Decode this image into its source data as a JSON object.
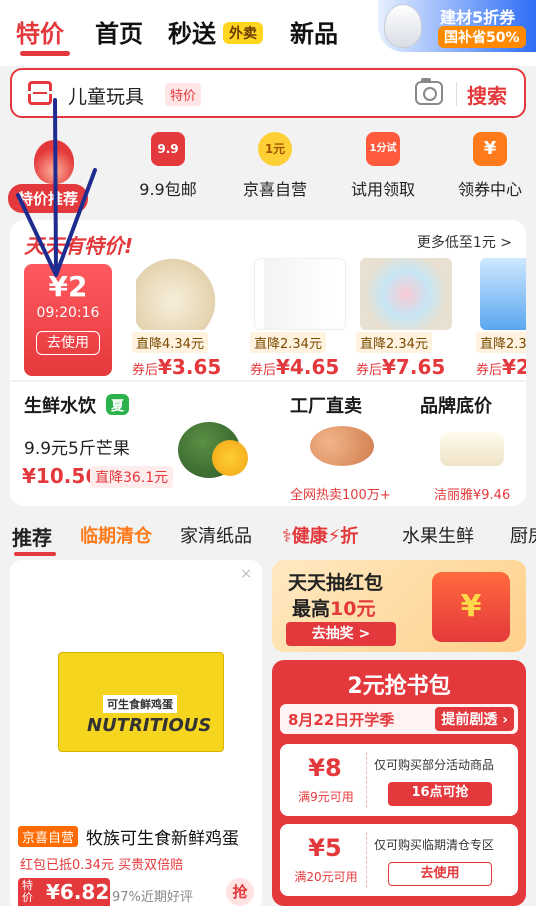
{
  "top_tabs": [
    {
      "label": "特价",
      "active": true
    },
    {
      "label": "首页"
    },
    {
      "label": "秒送"
    },
    {
      "label": "新品"
    }
  ],
  "waimai_badge": "外卖",
  "promo_banner": {
    "line1": "建材5折券",
    "line2": "国补省50%"
  },
  "search": {
    "text": "儿童玩具",
    "tag": "特价",
    "button": "搜索"
  },
  "quick_nav": {
    "tejia": {
      "label": "特价推荐"
    },
    "items": [
      {
        "icon_text": "9.9",
        "label": "9.9包邮"
      },
      {
        "icon_text": "1元",
        "label": "京喜自营"
      },
      {
        "icon_text": "1分试",
        "label": "试用领取"
      },
      {
        "icon_text": "¥",
        "label": "领券中心"
      }
    ]
  },
  "deals": {
    "title": "天天有特价!",
    "more": "更多低至1元 >",
    "coupon": {
      "amount": "¥2",
      "timer": "09:20:16",
      "button": "去使用"
    },
    "items": [
      {
        "drop": "直降4.34元",
        "after_label": "券后",
        "after_price": "¥3.65"
      },
      {
        "drop": "直降2.34元",
        "after_label": "券后",
        "after_price": "¥4.65"
      },
      {
        "drop": "直降2.34元",
        "after_label": "券后",
        "after_price": "¥7.65"
      },
      {
        "drop": "直降2.3",
        "after_label": "券后",
        "after_price": "¥2"
      }
    ]
  },
  "sub_sections": {
    "fresh": {
      "title": "生鲜水饮",
      "badge": "夏",
      "desc": "9.9元5斤芒果",
      "price": "¥10.56",
      "drop": "直降36.1元"
    },
    "factory": {
      "title": "工厂直卖",
      "sub": "全网热卖100万+"
    },
    "brand": {
      "title": "品牌底价",
      "sub": "洁丽雅¥9.46"
    }
  },
  "categories": [
    "推荐",
    "临期清仓",
    "家清纸品",
    "健康",
    "折",
    "水果生鲜",
    "厨房"
  ],
  "product": {
    "close": "×",
    "box_label": "可生食鲜鸡蛋",
    "box_brand": "NUTRITIOUS",
    "tag": "京喜自营",
    "title": "牧族可生食新鲜鸡蛋",
    "promo": "红包已抵0.34元  买贵双倍赔",
    "price_label": "特价",
    "price": "¥6.82",
    "rating": "97%近期好评",
    "grab": "抢"
  },
  "lucky": {
    "line1": "天天抽红包",
    "line2_prefix": "最高",
    "line2_amount": "10元",
    "button": "去抽奖 >",
    "packet_symbol": "¥"
  },
  "book": {
    "title": "2元抢书包",
    "date": "8月22日开学季",
    "preview": "提前剧透 ›",
    "coupons": [
      {
        "amount": "¥8",
        "condition": "满9元可用",
        "desc": "仅可购买部分活动商品",
        "button": "16点可抢"
      },
      {
        "amount": "¥5",
        "condition": "满20元可用",
        "desc": "仅可购买临期清仓专区",
        "button": "去使用"
      }
    ]
  },
  "colors": {
    "accent": "#e4393c",
    "annotation": "#1f2c8f"
  }
}
